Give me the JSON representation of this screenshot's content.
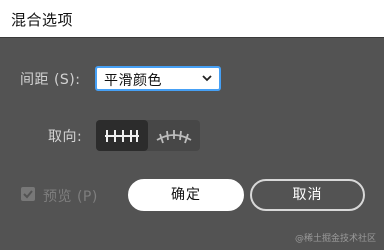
{
  "dialog": {
    "title": "混合选项"
  },
  "spacing": {
    "label": "间距 (S):",
    "selected": "平滑颜色"
  },
  "orientation": {
    "label": "取向:",
    "options": [
      "align-to-page-icon",
      "align-to-path-icon"
    ],
    "active": "align-to-page-icon"
  },
  "preview": {
    "label": "预览 (P)",
    "checked": true
  },
  "buttons": {
    "ok": "确定",
    "cancel": "取消"
  },
  "watermark": "@稀土掘金技术社区",
  "colors": {
    "background": "#535353",
    "titlebar": "#ffffff",
    "focus_border": "#46a0f5"
  }
}
